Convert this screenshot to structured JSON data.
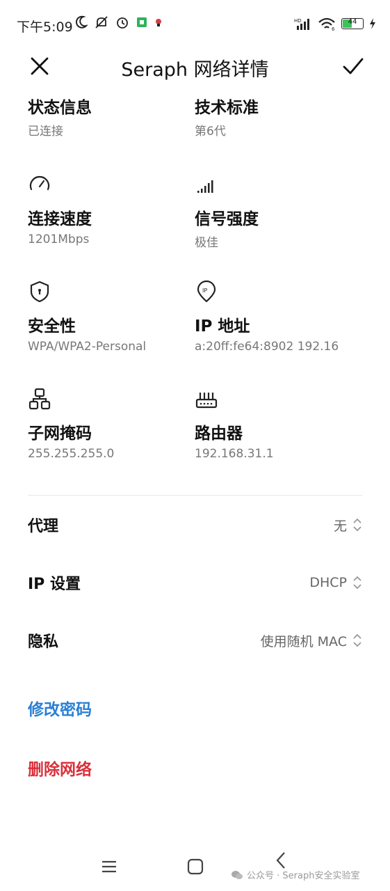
{
  "status_bar": {
    "time": "下午5:09",
    "battery": "44"
  },
  "header": {
    "title": "Seraph 网络详情"
  },
  "info_grid": [
    {
      "label": "状态信息",
      "value": "已连接"
    },
    {
      "label": "技术标准",
      "value": "第6代"
    },
    {
      "label": "连接速度",
      "value": "1201Mbps",
      "icon": "speedometer-icon"
    },
    {
      "label": "信号强度",
      "value": "极佳",
      "icon": "signal-bars-icon"
    },
    {
      "label": "安全性",
      "value": "WPA/WPA2-Personal",
      "icon": "shield-icon"
    },
    {
      "label": "IP 地址",
      "value": "a:20ff:fe64:8902 192.16",
      "icon": "ip-location-icon"
    },
    {
      "label": "子网掩码",
      "value": "255.255.255.0",
      "icon": "subnet-network-icon"
    },
    {
      "label": "路由器",
      "value": "192.168.31.1",
      "icon": "router-icon"
    }
  ],
  "settings": [
    {
      "label": "代理",
      "value": "无"
    },
    {
      "label": "IP 设置",
      "value": "DHCP"
    },
    {
      "label": "隐私",
      "value": "使用随机 MAC"
    }
  ],
  "actions": {
    "change_password": "修改密码",
    "delete_network": "删除网络"
  },
  "watermark": "公众号 · Seraph安全实验室",
  "colors": {
    "link_blue": "#2a7fd4",
    "danger_red": "#d9303a"
  }
}
